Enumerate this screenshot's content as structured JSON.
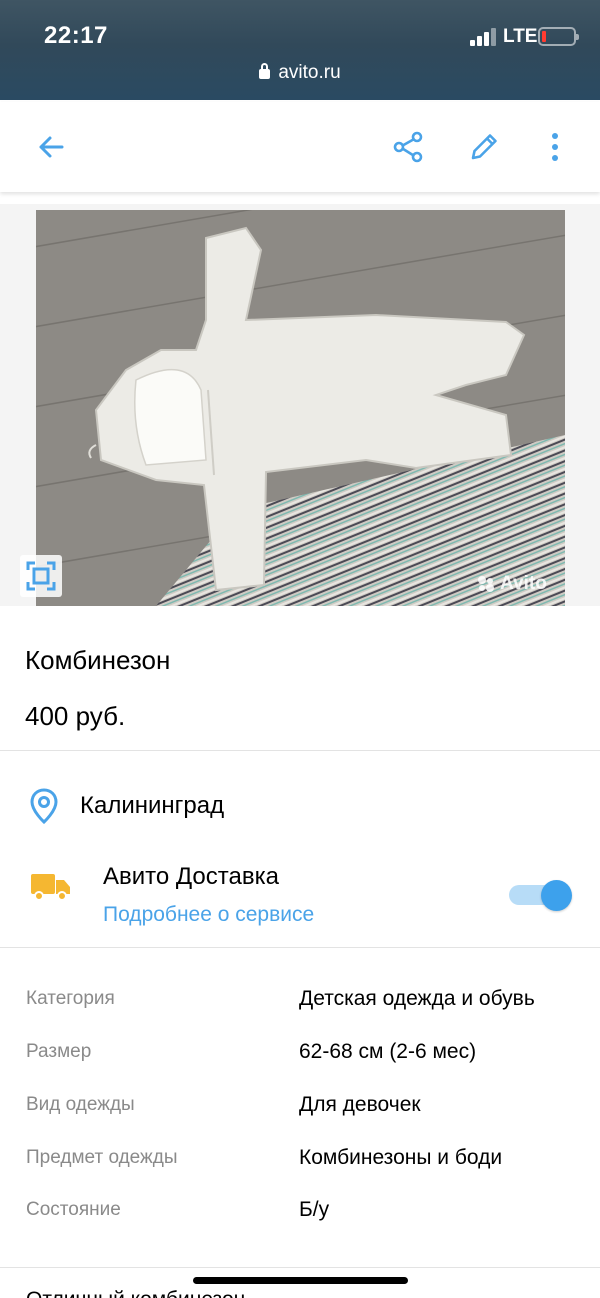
{
  "status_bar": {
    "time": "22:17",
    "network": "LTE",
    "url": "avito.ru"
  },
  "toolbar": {
    "back_icon": "arrow-left-icon",
    "share_icon": "share-icon",
    "edit_icon": "pencil-icon",
    "menu_icon": "more-vertical-icon",
    "accent_color": "#4aa3e8"
  },
  "photo": {
    "alt": "Комбинезон",
    "fullscreen_icon": "fullscreen-icon",
    "watermark": "Avito"
  },
  "listing": {
    "title": "Комбинезон",
    "price": "400 руб."
  },
  "location": {
    "icon": "map-pin-icon",
    "city": "Калининград"
  },
  "delivery": {
    "icon": "truck-icon",
    "title": "Авито Доставка",
    "link": "Подробнее о сервисе",
    "enabled": true
  },
  "params": [
    {
      "label": "Категория",
      "value": "Детская одежда и обувь"
    },
    {
      "label": "Размер",
      "value": "62-68 см (2-6 мес)"
    },
    {
      "label": "Вид одежды",
      "value": "Для девочек"
    },
    {
      "label": "Предмет одежды",
      "value": "Комбинезоны и боди"
    },
    {
      "label": "Состояние",
      "value": "Б/у"
    }
  ],
  "truncated_text": "Отличный комбинезон"
}
